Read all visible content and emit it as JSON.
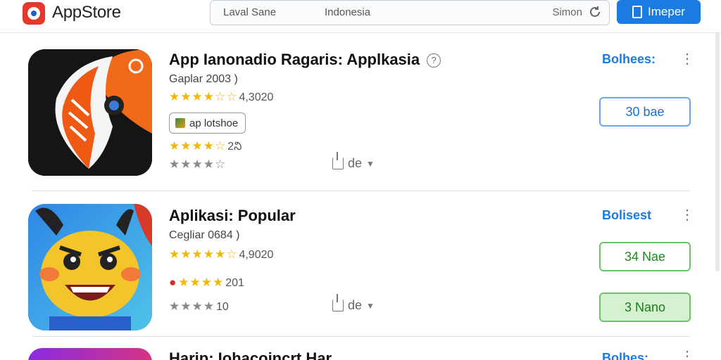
{
  "header": {
    "brand": "AppStore",
    "search_left": "Laval Sane",
    "search_mid": "Indonesia",
    "search_right": "Simon",
    "button_label": "Imeper"
  },
  "apps": [
    {
      "title": "App Ianonadio Ragaris: Applkasia",
      "info_glyph": "?",
      "subtitle": "Gaplar 2003 )",
      "rating_stars": "★★★★☆☆",
      "rating_value": "4,3020",
      "tag_label": "ap lotshoe",
      "rating2_stars": "★★★★☆",
      "rating2_value": "2ని",
      "rating3_stars": "★★★★☆",
      "share_label": "de",
      "side_label": "Bolhees:",
      "action_button": "30 bae"
    },
    {
      "title": "Aplikasi: Popular",
      "subtitle": "Cegliar 0684 )",
      "rating_stars": "★★★★★☆",
      "rating_value": "4,9020",
      "rating2_stars": "★★★★",
      "rating2_value": "201",
      "rating3_stars": "★★★★",
      "rating3_value": "10",
      "share_label": "de",
      "side_label": "Bolisest",
      "action_button": "34 Nae",
      "action_button2": "3 Nano"
    },
    {
      "title": "Harip: Iohacoincrt Har",
      "side_label": "Bolhes:"
    }
  ],
  "colors": {
    "accent": "#1a7be0",
    "star": "#f2b705",
    "green": "#6cc36c"
  }
}
